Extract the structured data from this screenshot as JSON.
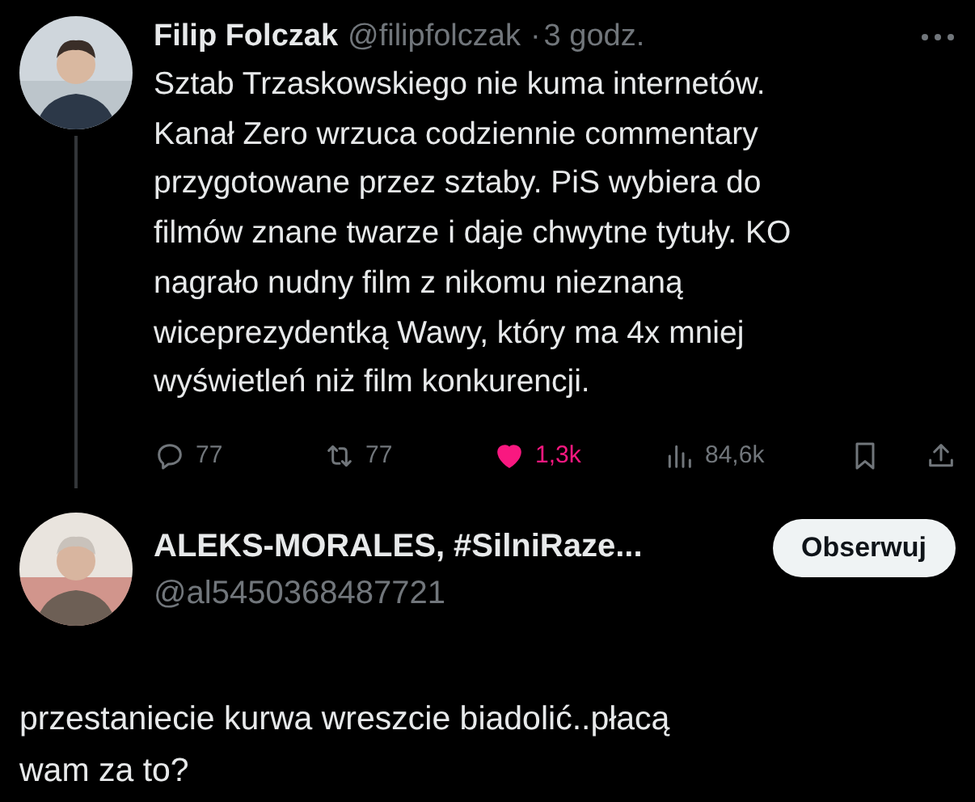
{
  "tweet": {
    "author": "Filip Folczak",
    "handle": "@filipfolczak",
    "separator": "·",
    "time": "3 godz.",
    "text": "Sztab Trzaskowskiego nie kuma internetów.\nKanał Zero wrzuca codziennie commentary\nprzygotowane przez sztaby. PiS wybiera do\nfilmów znane twarze i daje chwytne tytuły. KO\nnagrało nudny film z nikomu nieznaną\nwiceprezydentką Wawy, który ma 4x mniej\nwyświetleń niż film konkurencji.",
    "actions": [
      {
        "kind": "reply",
        "count": "77"
      },
      {
        "kind": "repost",
        "count": "77"
      },
      {
        "kind": "like",
        "count": "1,3k",
        "liked": true
      },
      {
        "kind": "views",
        "count": "84,6k"
      },
      {
        "kind": "bookmark"
      },
      {
        "kind": "share"
      }
    ]
  },
  "reply": {
    "author": "ALEKS-MORALES, #SilniRaze...",
    "handle": "@al5450368487721",
    "follow_button": "Obserwuj",
    "text": "przestaniecie kurwa wreszcie biadolić..płacą\nwam za to?"
  }
}
